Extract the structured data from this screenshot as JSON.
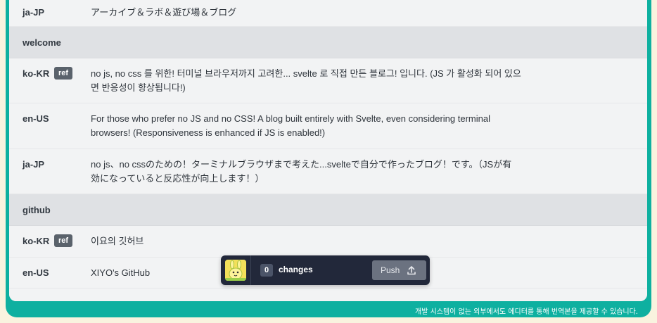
{
  "rows": [
    {
      "lang": "ja-JP",
      "text": "アーカイブ＆ラボ＆遊び場＆ブログ"
    },
    {
      "section": "welcome"
    },
    {
      "lang": "ko-KR",
      "ref": "ref",
      "text": "no js, no css 를 위한! 터미널 브라우저까지 고려한... svelte 로 직접 만든 블로그! 입니다. (JS 가 활성화 되어 있으면 반응성이 향상됩니다!)"
    },
    {
      "lang": "en-US",
      "text": "For those who prefer no JS and no CSS! A blog built entirely with Svelte, even considering terminal browsers! (Responsiveness is enhanced if JS is enabled!)"
    },
    {
      "lang": "ja-JP",
      "text": "no js、no cssのための！ターミナルブラウザまで考えた...svelteで自分で作ったブログ！です。（JSが有効になっていると反応性が向上します！）"
    },
    {
      "section": "github"
    },
    {
      "lang": "ko-KR",
      "ref": "ref",
      "text": "이요의 깃허브"
    },
    {
      "lang": "en-US",
      "text": "XIYO's GitHub"
    }
  ],
  "toolbar": {
    "count": "0",
    "changes_label": "changes",
    "push_label": "Push",
    "push_icon": "upload-icon",
    "avatar_icon": "yellow-mascot-avatar"
  },
  "footer_note": "개발 시스템이 없는 외부에서도 에디터를 통해 번역본을 제공할 수 있습니다.",
  "colors": {
    "frame": "#0eb0a0",
    "page_background": "#f9f3df",
    "row": "#f2f3f4",
    "section_row": "#dfe1e4",
    "toolbar": "#22283a",
    "push_button": "#6b7280"
  }
}
